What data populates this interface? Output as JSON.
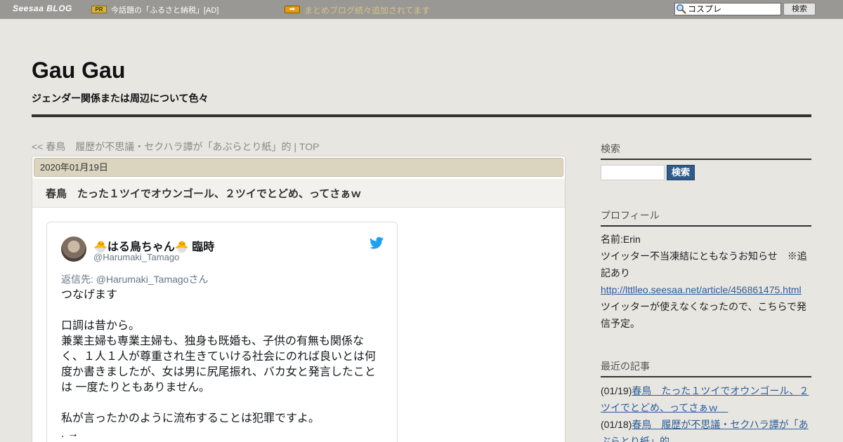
{
  "topbar": {
    "brand": "Seesaa BLOG",
    "pr_label": "PR",
    "pr_text": "今話題の「ふるさと納税」[AD]",
    "notice_text": "まとめブログ続々追加されてます",
    "search_value": "コスプレ",
    "search_button": "検索"
  },
  "header": {
    "title": "Gau Gau",
    "description": "ジェンダー関係または周辺について色々"
  },
  "breadcrumb": {
    "prev_link": "<< 春鳥　履歴が不思議・セクハラ譚が「あぶらとり紙」的",
    "separator": " | ",
    "top_link": "TOP"
  },
  "article": {
    "date": "2020年01月19日",
    "title": "春鳥　たった１ツイでオウンゴール、２ツイでとどめ、ってさぁｗ"
  },
  "tweet": {
    "name": "🐣はる鳥ちゃん🐣 臨時",
    "handle": "@Harumaki_Tamago",
    "reply_to": "返信先: @Harumaki_Tamagoさん",
    "line1": "つなげます",
    "line2": "口調は昔から。",
    "line3": "兼業主婦も専業主婦も、独身も既婚も、子供の有無も関係なく、１人１人が尊重され生きていける社会にのれば良いとは何度か書きましたが、女は男に尻尾振れ、バカ女と発言したことは 一度たりともありません。",
    "line4": "私が言ったかのように流布することは犯罪ですよ。",
    "line5": ". →"
  },
  "sidebar": {
    "search_heading": "検索",
    "search_button": "検索",
    "profile_heading": "プロフィール",
    "profile_name": "名前:Erin",
    "profile_notice": "ツイッター不当凍結にともなうお知らせ　※追記あり",
    "profile_link": "http://lttlleo.seesaa.net/article/456861475.html",
    "profile_note": "ツイッターが使えなくなったので、こちらで発信予定。",
    "recent_heading": "最近の記事",
    "recent": [
      {
        "date": "(01/19)",
        "title": "春鳥　たった１ツイでオウンゴール、２ツイでとどめ、ってさぁｗ　"
      },
      {
        "date": "(01/18)",
        "title": "春鳥　履歴が不思議・セクハラ譚が「あぶらとり紙」的"
      }
    ]
  },
  "colors": {
    "topbar": "#999894",
    "page_bg": "#e8e6e1",
    "link": "#2a5d9a",
    "accent_button": "#2f5b8a"
  }
}
